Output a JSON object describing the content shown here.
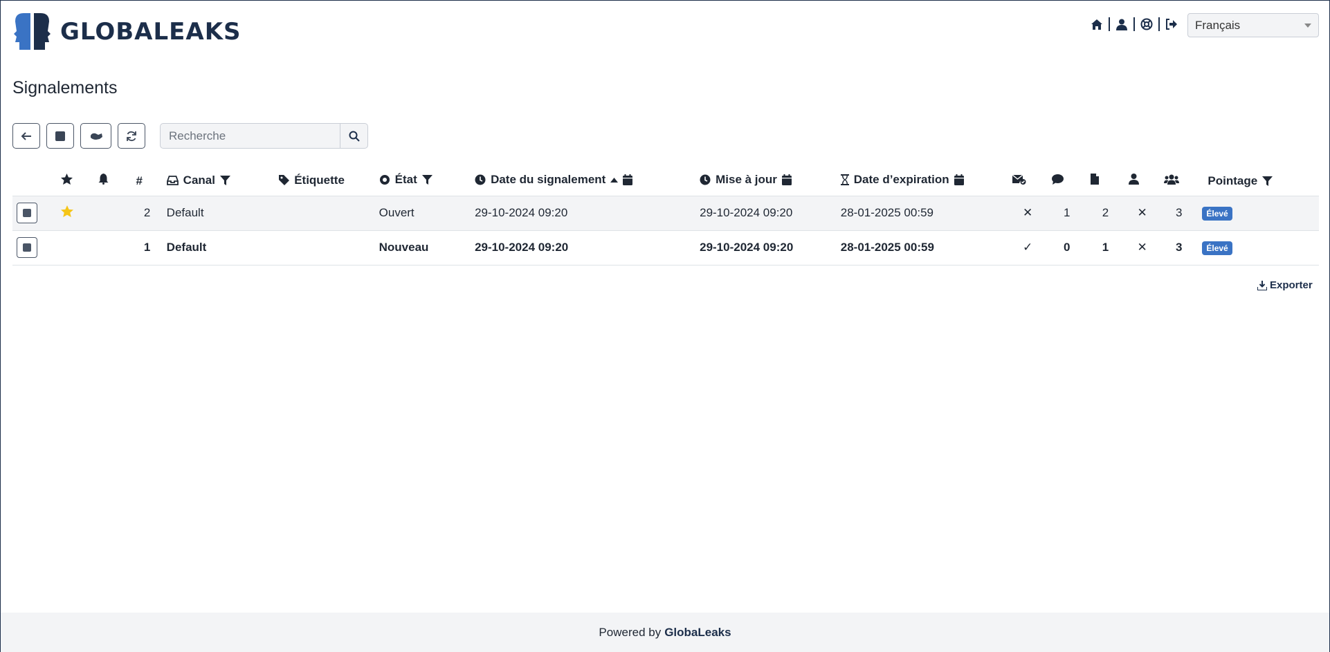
{
  "brand": {
    "name": "GLOBALEAKS"
  },
  "nav": {
    "icons": [
      "home-icon",
      "user-icon",
      "support-icon",
      "logout-icon"
    ],
    "language": "Français"
  },
  "page": {
    "title": "Signalements"
  },
  "toolbar": {
    "buttons": [
      "back-arrow-icon",
      "select-all-icon",
      "transfer-icon",
      "refresh-icon"
    ],
    "search_placeholder": "Recherche"
  },
  "table": {
    "headers": {
      "hash": "#",
      "channel": "Canal",
      "label": "Étiquette",
      "status": "État",
      "report_date": "Date du signalement",
      "update": "Mise à jour",
      "expiry": "Date d’expiration",
      "score": "Pointage"
    },
    "rows": [
      {
        "starred": true,
        "id": "2",
        "channel": "Default",
        "label": "",
        "status": "Ouvert",
        "report_date": "29-10-2024 09:20",
        "update": "29-10-2024 09:20",
        "expiry": "28-01-2025 00:59",
        "read": "✕",
        "comments": "1",
        "files": "2",
        "whistleblower": "✕",
        "recipients": "3",
        "score": "Élevé"
      },
      {
        "starred": false,
        "id": "1",
        "channel": "Default",
        "label": "",
        "status": "Nouveau",
        "report_date": "29-10-2024 09:20",
        "update": "29-10-2024 09:20",
        "expiry": "28-01-2025 00:59",
        "read": "✓",
        "comments": "0",
        "files": "1",
        "whistleblower": "✕",
        "recipients": "3",
        "score": "Élevé"
      }
    ]
  },
  "export_label": "Exporter",
  "footer": {
    "prefix": "Powered by",
    "brand": "GlobaLeaks"
  },
  "colors": {
    "brand": "#1c2e4a",
    "accent": "#3a73c4",
    "star": "#f5c518"
  }
}
